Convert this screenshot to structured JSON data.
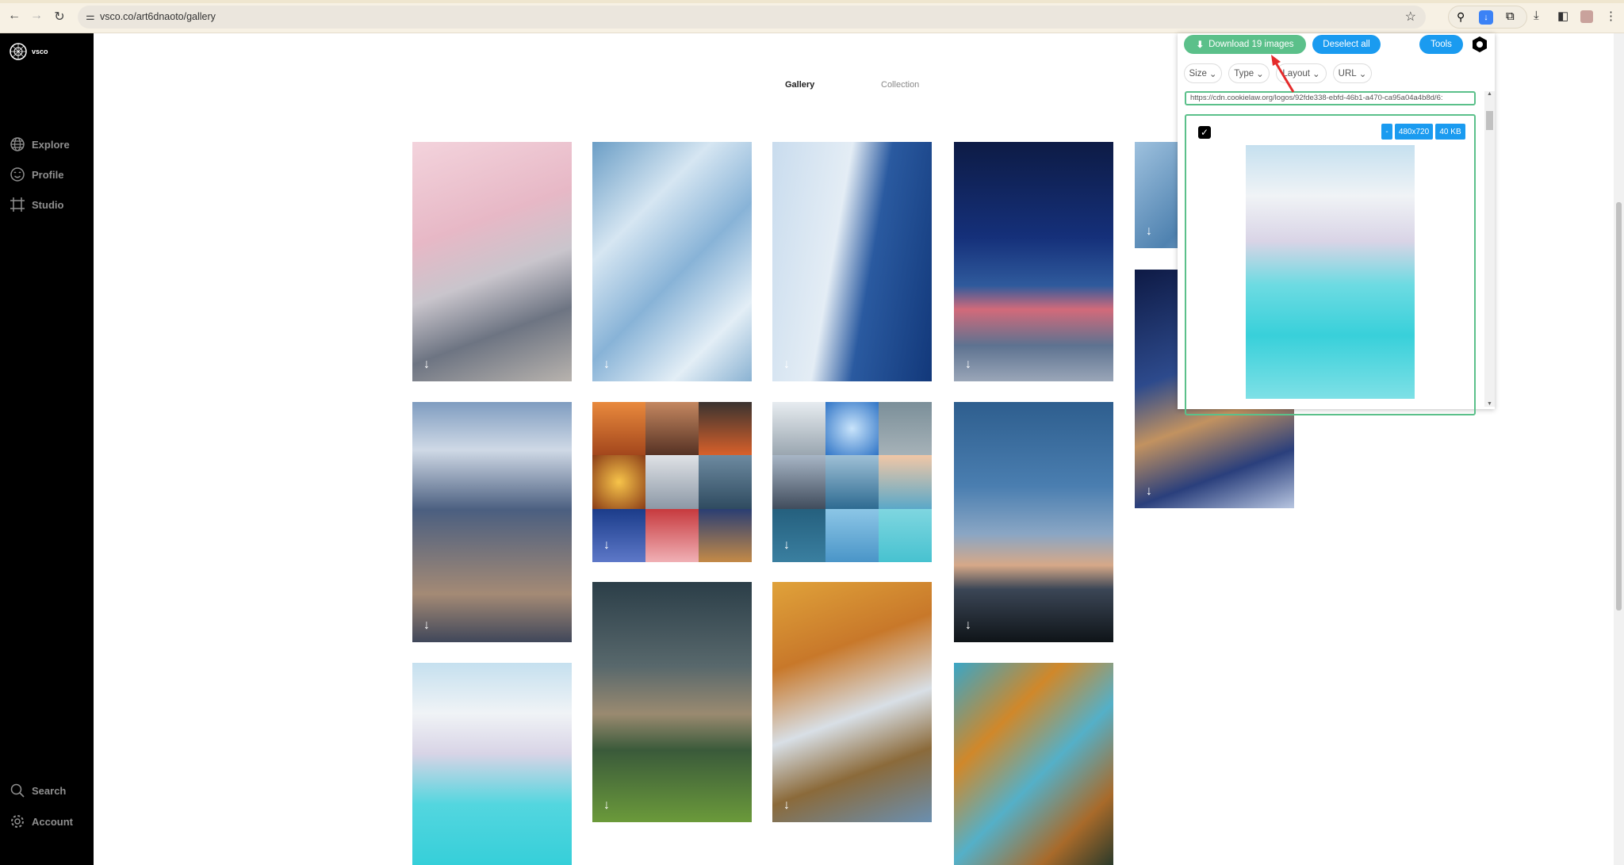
{
  "browser": {
    "url": "vsco.co/art6dnaoto/gallery"
  },
  "sidebar": {
    "logo": "vsco",
    "items": [
      {
        "label": "Explore",
        "icon": "globe-icon"
      },
      {
        "label": "Profile",
        "icon": "smiley-icon"
      },
      {
        "label": "Studio",
        "icon": "crop-icon"
      }
    ],
    "bottom": [
      {
        "label": "Search",
        "icon": "search-icon"
      },
      {
        "label": "Account",
        "icon": "gear-icon"
      }
    ]
  },
  "tabs": [
    {
      "label": "Gallery",
      "active": true
    },
    {
      "label": "Collection",
      "active": false
    }
  ],
  "popup": {
    "download_label": "Download 19 images",
    "deselect_label": "Deselect all",
    "tools_label": "Tools",
    "filters": [
      "Size",
      "Type",
      "Layout",
      "URL"
    ],
    "url_value": "https://cdn.cookielaw.org/logos/92fde338-ebfd-46b1-a470-ca95a04a4b8d/6:",
    "card": {
      "checked": true,
      "badges": [
        "-",
        "480x720",
        "40 KB"
      ]
    },
    "colors": {
      "green": "#5bc08a",
      "blue": "#1a9bf0"
    }
  }
}
